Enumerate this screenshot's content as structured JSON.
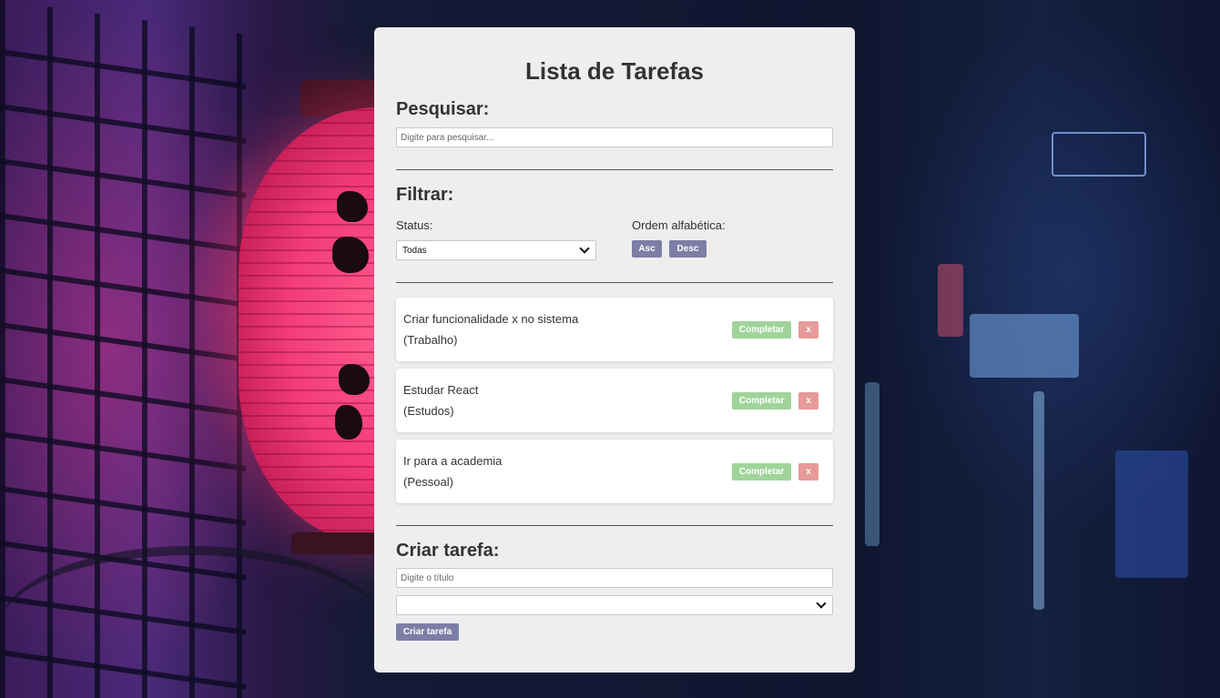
{
  "app": {
    "title": "Lista de Tarefas"
  },
  "search": {
    "heading": "Pesquisar:",
    "value": "",
    "placeholder": "Digite para pesquisar..."
  },
  "filter": {
    "heading": "Filtrar:",
    "status_label": "Status:",
    "status_selected": "Todas",
    "sort_label": "Ordem alfabética:",
    "asc_label": "Asc",
    "desc_label": "Desc"
  },
  "tasks": [
    {
      "title": "Criar funcionalidade x no sistema",
      "category": "(Trabalho)",
      "complete_label": "Completar",
      "delete_label": "x"
    },
    {
      "title": "Estudar React",
      "category": "(Estudos)",
      "complete_label": "Completar",
      "delete_label": "x"
    },
    {
      "title": "Ir para a academia",
      "category": "(Pessoal)",
      "complete_label": "Completar",
      "delete_label": "x"
    }
  ],
  "create": {
    "heading": "Criar tarefa:",
    "title_value": "",
    "title_placeholder": "Digite o título",
    "category_selected": "",
    "submit_label": "Criar tarefa"
  },
  "colors": {
    "card_bg": "#eeeeee",
    "primary_button": "#7c7ea6",
    "complete_button": "#9fd49a",
    "delete_button": "#e69a9a",
    "text": "#333333"
  },
  "icons": {
    "select_arrow": "chevron-down-icon"
  }
}
